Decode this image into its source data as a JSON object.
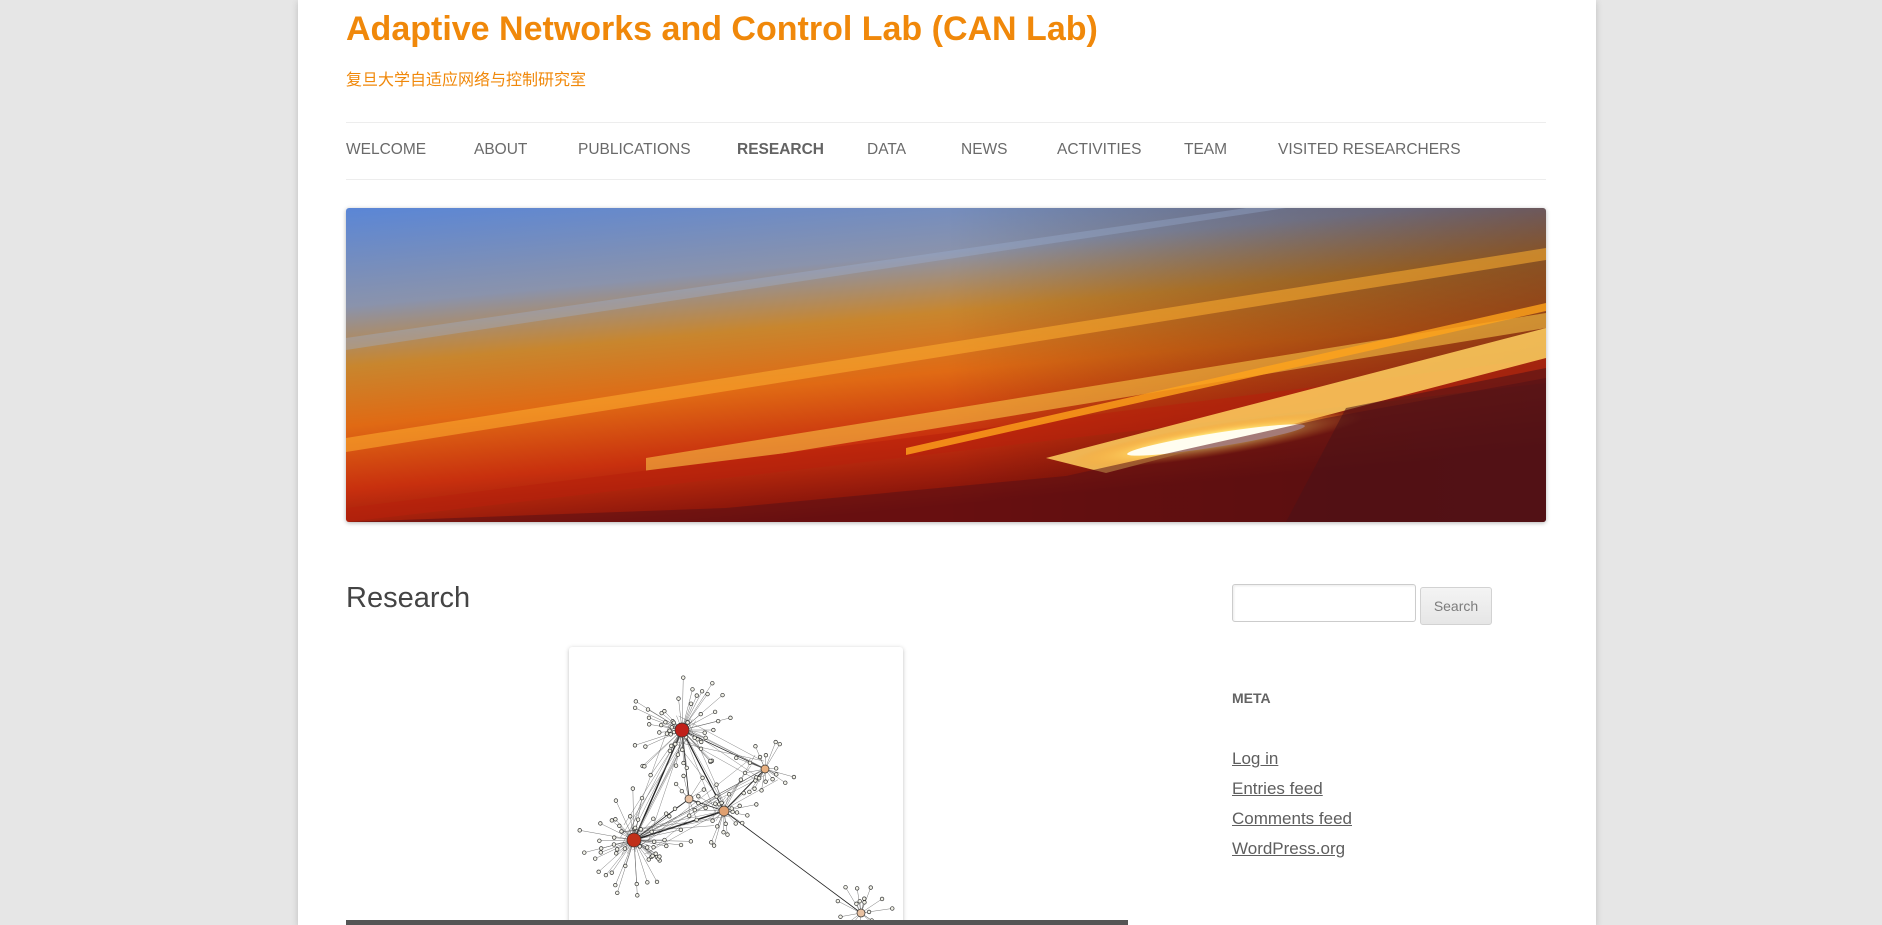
{
  "site": {
    "title": "Adaptive Networks and Control Lab (CAN Lab)",
    "description": "复旦大学自适应网络与控制研究室",
    "accent_color": "#f0880a"
  },
  "nav": {
    "items": [
      {
        "label": "WELCOME",
        "current": false
      },
      {
        "label": "ABOUT",
        "current": false
      },
      {
        "label": "PUBLICATIONS",
        "current": false
      },
      {
        "label": "RESEARCH",
        "current": true
      },
      {
        "label": "DATA",
        "current": false
      },
      {
        "label": "NEWS",
        "current": false
      },
      {
        "label": "ACTIVITIES",
        "current": false
      },
      {
        "label": "TEAM",
        "current": false
      },
      {
        "label": "VISITED RESEARCHERS",
        "current": false
      }
    ]
  },
  "main": {
    "page_title": "Research"
  },
  "sidebar": {
    "search": {
      "value": "",
      "placeholder": "",
      "button_label": "Search"
    },
    "meta": {
      "title": "META",
      "links": [
        "Log in",
        "Entries feed",
        "Comments feed",
        "WordPress.org"
      ]
    }
  }
}
